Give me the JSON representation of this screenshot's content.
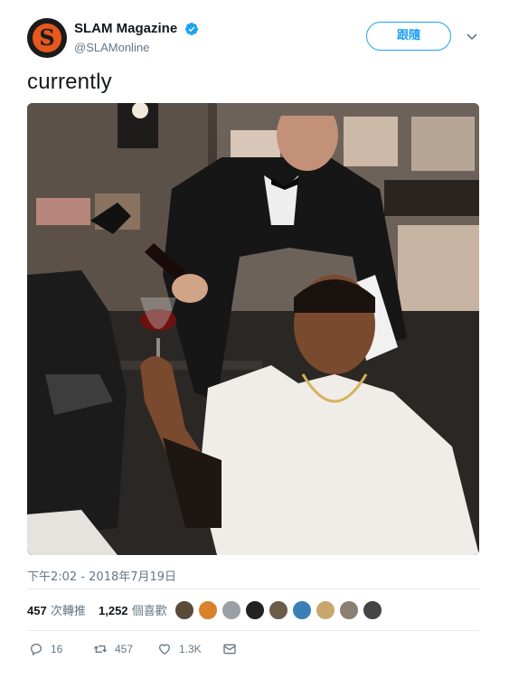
{
  "tweet": {
    "author": {
      "display_name": "SLAM Magazine",
      "handle": "@SLAMonline",
      "avatar_letter": "S",
      "verified": true
    },
    "follow_label": "跟隨",
    "text": "currently",
    "timestamp": "下午2:02 - 2018年7月19日",
    "stats": {
      "retweets_count": "457",
      "retweets_label": "次轉推",
      "likes_count": "1,252",
      "likes_label": "個喜歡"
    },
    "liker_avatars": [
      "#5a4a3a",
      "#d9822b",
      "#9aa0a6",
      "#222222",
      "#6b5b4b",
      "#3b7fb8",
      "#c9a66b",
      "#8a7f72",
      "#444444"
    ],
    "actions": {
      "reply_count": "16",
      "retweet_count": "457",
      "like_count": "1.3K"
    }
  },
  "colors": {
    "accent": "#1da1f2",
    "secondary_text": "#657786",
    "brand_orange": "#e8571c"
  }
}
